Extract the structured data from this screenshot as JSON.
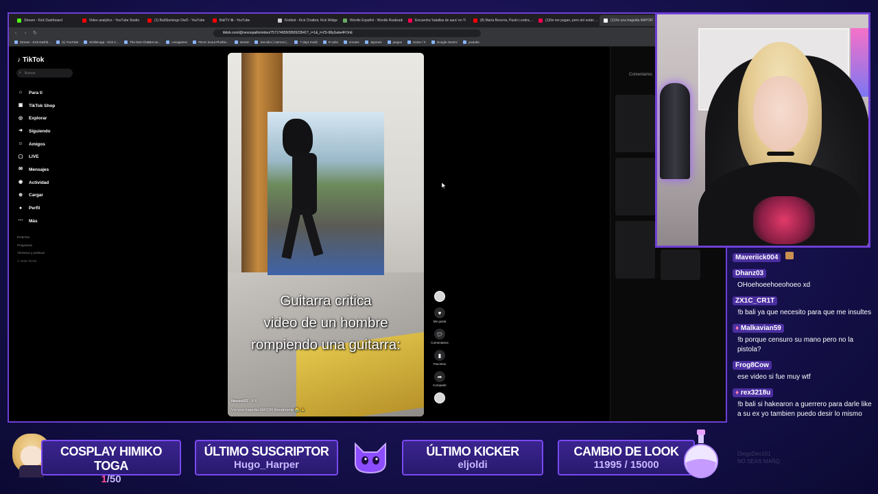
{
  "browser": {
    "tabs": [
      {
        "label": "Stream - Kick Dashboard",
        "color": "#53fc18"
      },
      {
        "label": "Video analytics - YouTube Studio",
        "color": "#ff0000"
      },
      {
        "label": "(1) BaliSlamingo OwO - YouTube",
        "color": "#ff0000"
      },
      {
        "label": "BaliTV ✪ - YouTube",
        "color": "#ff0000"
      },
      {
        "label": "Kickbot - Kick Chatbot, Kick Widge",
        "color": "#cccccc"
      },
      {
        "label": "Wordle Español - Wordle Realizado",
        "color": "#6aaa64"
      },
      {
        "label": "Encuentra 'batallas de aura' en Ti",
        "color": "#ff0050"
      },
      {
        "label": "(8) María Becerra, Paulo Londra, ...",
        "color": "#ff0000"
      },
      {
        "label": "(1)No me pagan, pero ahí están ...",
        "color": "#ff0050"
      },
      {
        "label": "(1)Vio una tragedia MAYOR",
        "color": "#ffffff",
        "active": true
      }
    ],
    "url": "tiktok.com/@nexoopalito/video/7571746550950923541?_r=1&_t=ZS-98yGaIw4FOnE",
    "bookmarks": [
      "Stream - Kick Dashb...",
      "(1) YouTube",
      "Kicklet.app - Kick C...",
      "The best ChatBot an...",
      "Lessgames",
      "PEAK Scout Plushie...",
      "stream",
      "Servidor | Aternos |...",
      "7 days mods",
      "R subs",
      "emotes",
      "Japones",
      "juegos",
      "Home / X",
      "Google Gemini",
      "youtube"
    ]
  },
  "tiktok": {
    "logo": "TikTok",
    "search_placeholder": "Buscar",
    "nav": [
      {
        "label": "Para ti",
        "icon": "home-icon",
        "glyph": "⌂"
      },
      {
        "label": "TikTok Shop",
        "icon": "shop-icon",
        "glyph": "▣"
      },
      {
        "label": "Explorar",
        "icon": "compass-icon",
        "glyph": "◎"
      },
      {
        "label": "Siguiendo",
        "icon": "following-icon",
        "glyph": "➜"
      },
      {
        "label": "Amigos",
        "icon": "friends-icon",
        "glyph": "☺"
      },
      {
        "label": "LIVE",
        "icon": "live-icon",
        "glyph": "▢"
      },
      {
        "label": "Mensajes",
        "icon": "messages-icon",
        "glyph": "✉"
      },
      {
        "label": "Actividad",
        "icon": "activity-icon",
        "glyph": "◉"
      },
      {
        "label": "Cargar",
        "icon": "upload-icon",
        "glyph": "⊕"
      },
      {
        "label": "Perfil",
        "icon": "profile-icon",
        "glyph": "●"
      },
      {
        "label": "Más",
        "icon": "more-icon",
        "glyph": "⋯"
      }
    ],
    "footer": {
      "empresa": "Empresa",
      "programas": "Programas",
      "terminos": "Términos y políticas",
      "copyright": "© 2026 TikTok"
    },
    "video": {
      "caption_line1": "Guitarra critica",
      "caption_line2": "video de un hombre",
      "caption_line3": "rompiendo una guitarra:",
      "author": "NexooXD",
      "date": "· 8-8",
      "description": "Vio una tragedia MAYOR literalmente 😭 🙏"
    },
    "actions": {
      "like": "Me gusta",
      "comments": "Comentarios",
      "favorites": "Favoritos",
      "share": "Compartir"
    },
    "comments_title": "Comentarios"
  },
  "chat": [
    {
      "user": "Maveriick004",
      "text": "",
      "emote": true
    },
    {
      "user": "Dhanz03",
      "text": "OHoehoeehoeohoeo xd"
    },
    {
      "user": "ZX1C_CR1T",
      "text": "!b bali ya que necesito para que me insultes"
    },
    {
      "user": "Malkavian59",
      "text": "!b porque censuro su mano pero no la pistola?",
      "badge": true
    },
    {
      "user": "Frog8Cow",
      "text": "ese video si fue muy wtf"
    },
    {
      "user": "rex3218u",
      "text": "!b bali si hakearon a guerrero para darle like a su ex yo tambien puedo desir lo mismo",
      "badge": true
    }
  ],
  "chat_ghost": {
    "line1": "DiegoDev101",
    "line2": "NO SEAS MAÑQ"
  },
  "overlay": {
    "cosplay_title": "COSPLAY HIMIKO TOGA",
    "cosplay_current": "1",
    "cosplay_total": "/50",
    "sub_title": "ÚLTIMO SUSCRIPTOR",
    "sub_name": "Hugo_Harper",
    "kicker_title": "ÚLTIMO KICKER",
    "kicker_name": "eljoldi",
    "look_title": "CAMBIO DE LOOK",
    "look_progress": "11995 / 15000",
    "accent": "#7a49f0"
  }
}
